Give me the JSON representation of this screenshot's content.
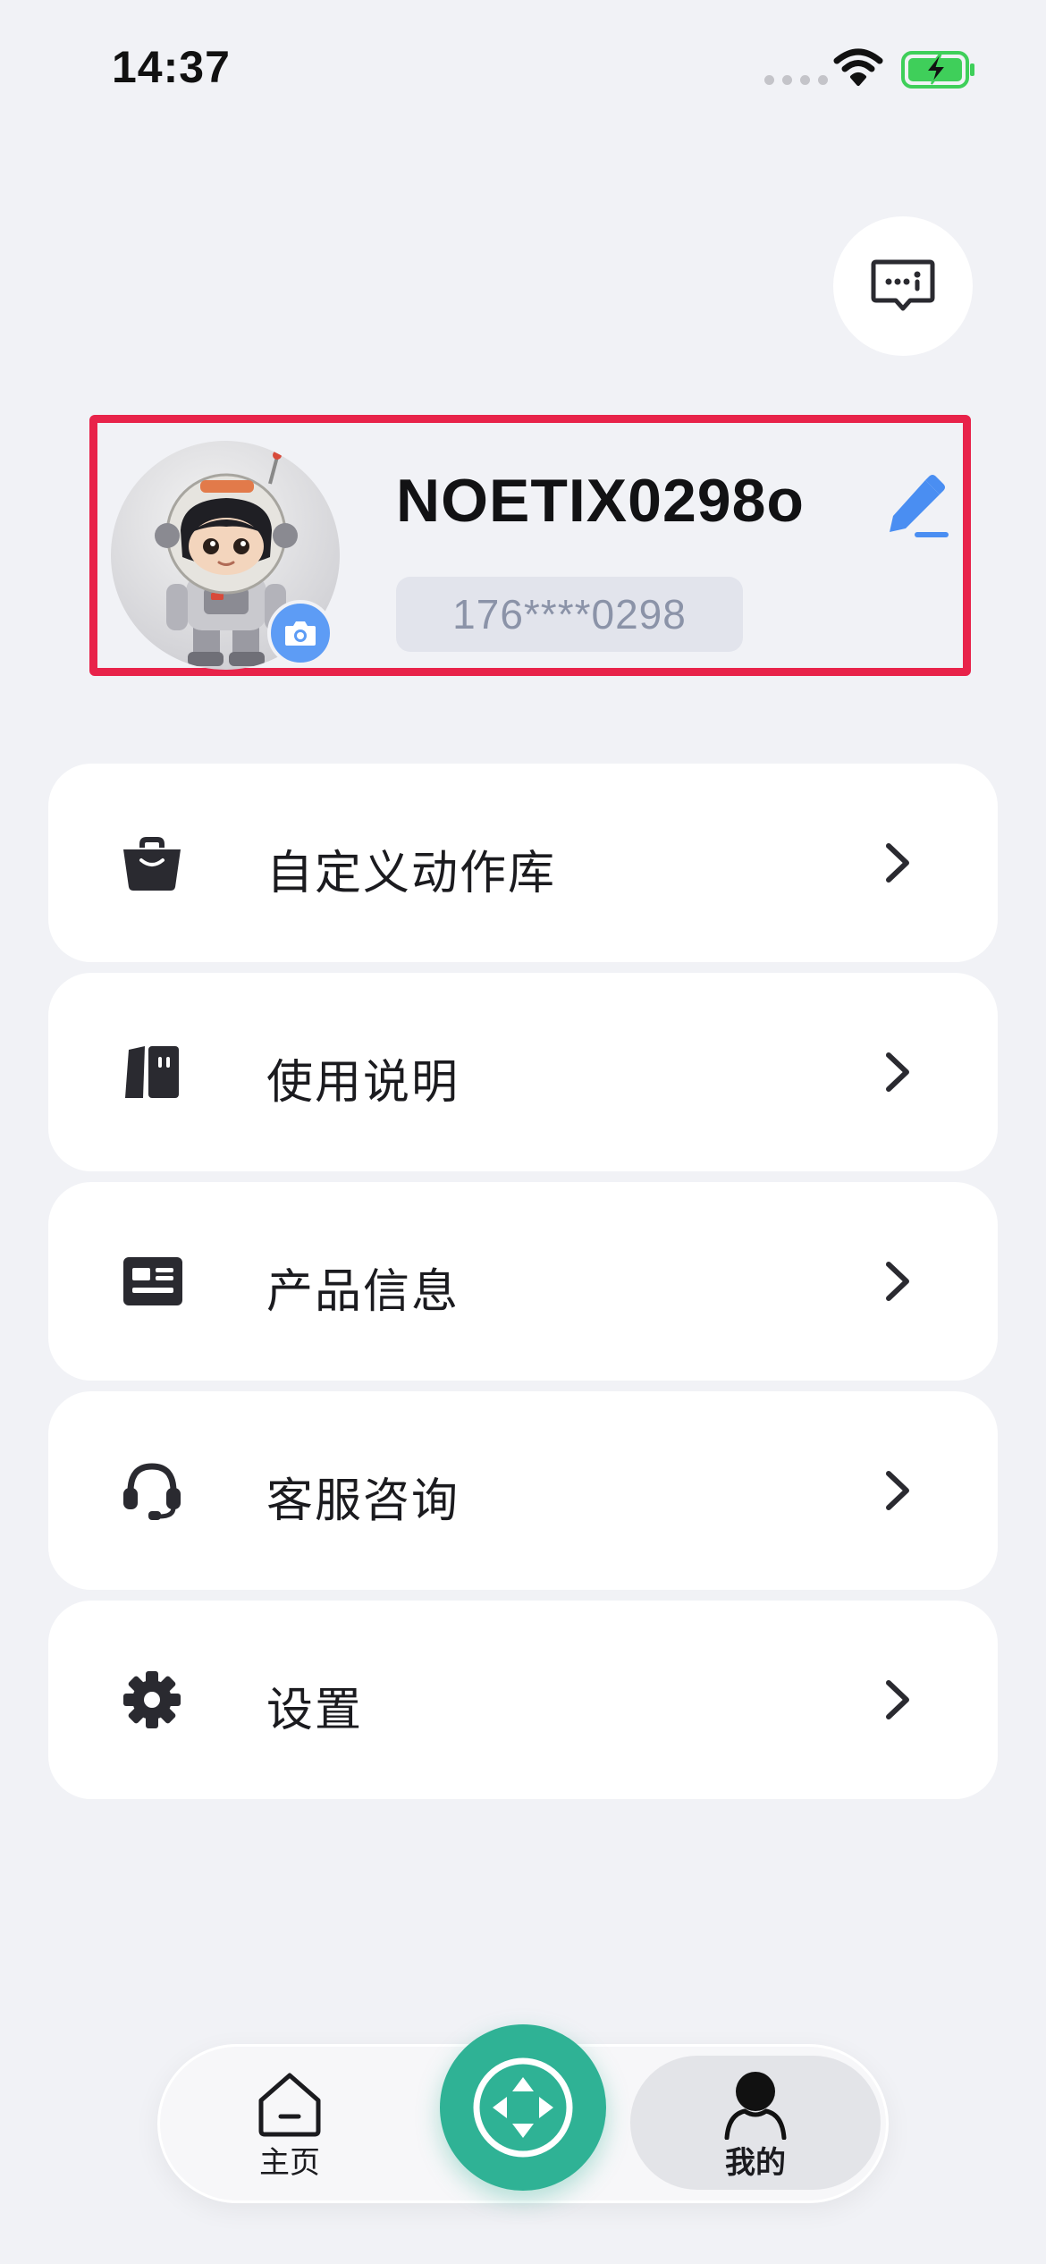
{
  "status_bar": {
    "time": "14:37"
  },
  "profile": {
    "username": "NOETIX0298o",
    "phone": "176****0298"
  },
  "menu": [
    {
      "label": "自定义动作库",
      "icon": "toolbox-icon"
    },
    {
      "label": "使用说明",
      "icon": "book-icon"
    },
    {
      "label": "产品信息",
      "icon": "id-card-icon"
    },
    {
      "label": "客服咨询",
      "icon": "headset-icon"
    },
    {
      "label": "设置",
      "icon": "gear-icon"
    }
  ],
  "bottom_nav": {
    "home_label": "主页",
    "mine_label": "我的",
    "active": "mine"
  },
  "colors": {
    "background": "#f1f2f6",
    "accent_blue": "#5d9cf5",
    "center_button": "#2fb295",
    "highlight_border": "#e8234a",
    "battery_green": "#3fcf5a"
  }
}
